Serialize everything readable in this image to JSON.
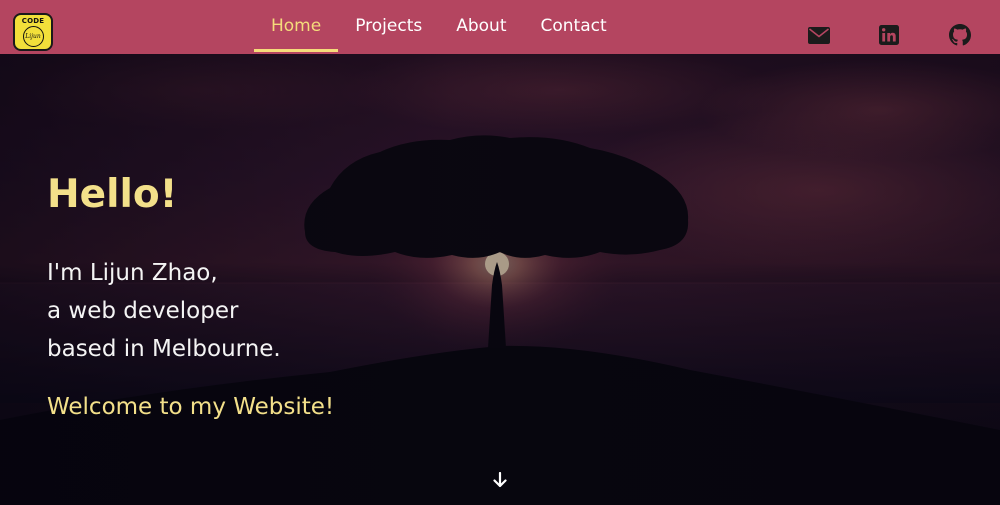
{
  "logo": {
    "text": "CODE",
    "signature": "Lijun",
    "colors": {
      "background": "#f2df3a",
      "border": "#1a1a1a"
    }
  },
  "nav": {
    "items": [
      {
        "label": "Home",
        "active": true
      },
      {
        "label": "Projects",
        "active": false
      },
      {
        "label": "About",
        "active": false
      },
      {
        "label": "Contact",
        "active": false
      }
    ],
    "social": [
      {
        "icon": "mail-icon"
      },
      {
        "icon": "linkedin-icon"
      },
      {
        "icon": "github-icon"
      }
    ],
    "colors": {
      "background": "#b44560",
      "active": "#f5dc7b",
      "text": "#ffffff",
      "icon": "#1b1b1b"
    }
  },
  "hero": {
    "greeting": "Hello!",
    "intro_lines": [
      "I'm Lijun Zhao,",
      "a web developer",
      "based in Melbourne."
    ],
    "welcome": "Welcome to my Website!",
    "scroll_icon": "arrow-down-icon",
    "colors": {
      "accent": "#f3e08a",
      "text": "#f4f4f4"
    }
  }
}
